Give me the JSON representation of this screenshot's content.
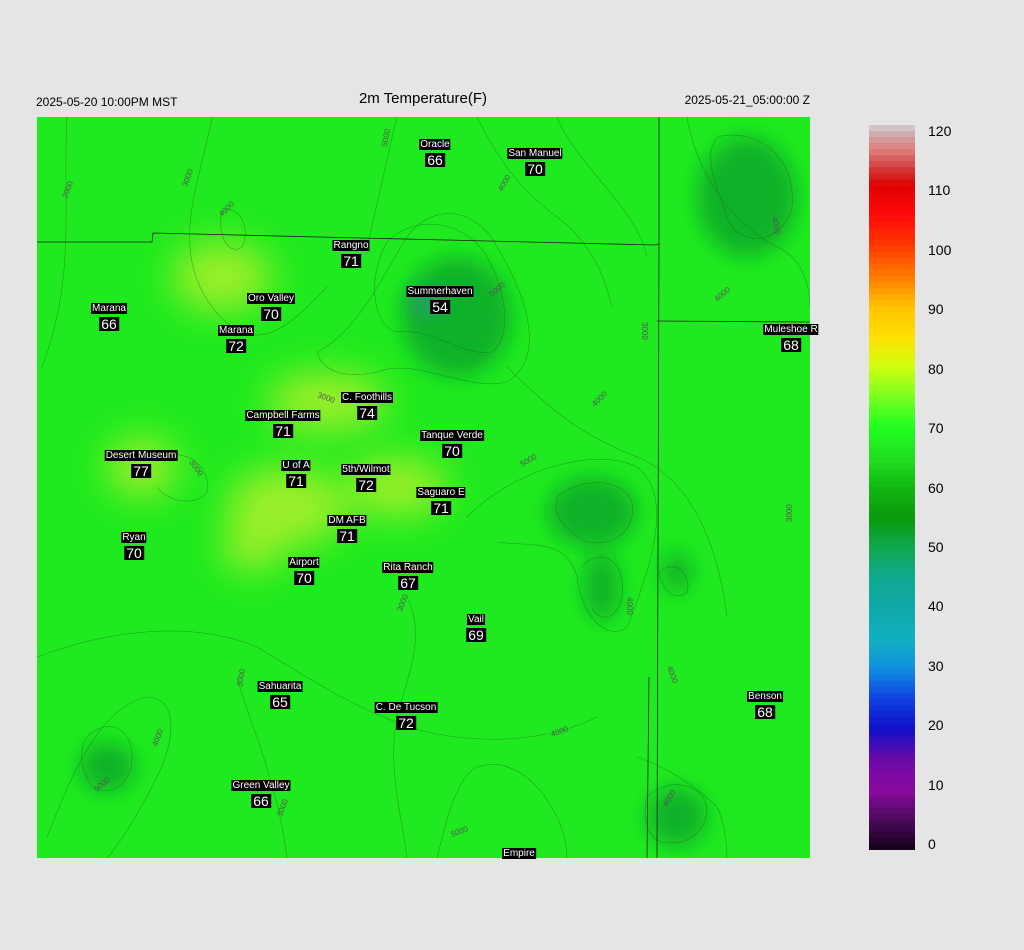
{
  "header": {
    "left": "2025-05-20 10:00PM MST",
    "title": "2m Temperature(F)",
    "right": "2025-05-21_05:00:00 Z"
  },
  "colors": {
    "background": "#e5e5e5",
    "map_base": "#1fea1f",
    "warm": "#a8f02a",
    "cool": "#0aa82a",
    "cold_peak": "#2c9b6e",
    "boundary": "#222222",
    "contour": "#1a6a1a"
  },
  "legend": {
    "ticks": [
      "120",
      "110",
      "100",
      "90",
      "80",
      "70",
      "60",
      "50",
      "40",
      "30",
      "20",
      "10",
      "0"
    ]
  },
  "stations": [
    {
      "name": "Oracle",
      "value": "66"
    },
    {
      "name": "San Manuel",
      "value": "70"
    },
    {
      "name": "Rangno",
      "value": "71"
    },
    {
      "name": "Summerhaven",
      "value": "54"
    },
    {
      "name": "Marana",
      "value": "66"
    },
    {
      "name": "Oro Valley",
      "value": "70"
    },
    {
      "name": "Marana",
      "value": "72"
    },
    {
      "name": "Muleshoe R",
      "value": "68"
    },
    {
      "name": "C. Foothills",
      "value": "74"
    },
    {
      "name": "Campbell Farms",
      "value": "71"
    },
    {
      "name": "Tanque Verde",
      "value": "70"
    },
    {
      "name": "Desert Museum",
      "value": "77"
    },
    {
      "name": "U of A",
      "value": "71"
    },
    {
      "name": "5th/Wilmot",
      "value": "72"
    },
    {
      "name": "Saguaro E",
      "value": "71"
    },
    {
      "name": "DM AFB",
      "value": "71"
    },
    {
      "name": "Ryan",
      "value": "70"
    },
    {
      "name": "Airport",
      "value": "70"
    },
    {
      "name": "Rita Ranch",
      "value": "67"
    },
    {
      "name": "Vail",
      "value": "69"
    },
    {
      "name": "Sahuarita",
      "value": "65"
    },
    {
      "name": "C. De Tucson",
      "value": "72"
    },
    {
      "name": "Benson",
      "value": "68"
    },
    {
      "name": "Green Valley",
      "value": "66"
    },
    {
      "name": "Empire",
      "value": ""
    }
  ],
  "contour_labels": [
    "2000",
    "3000",
    "4000",
    "5000",
    "3000",
    "4000",
    "5000",
    "4000",
    "3000",
    "3000",
    "4000",
    "5000",
    "4000",
    "3000",
    "4000",
    "3000",
    "4000",
    "5000",
    "3000",
    "4000",
    "4000",
    "5000",
    "3000",
    "4000"
  ]
}
